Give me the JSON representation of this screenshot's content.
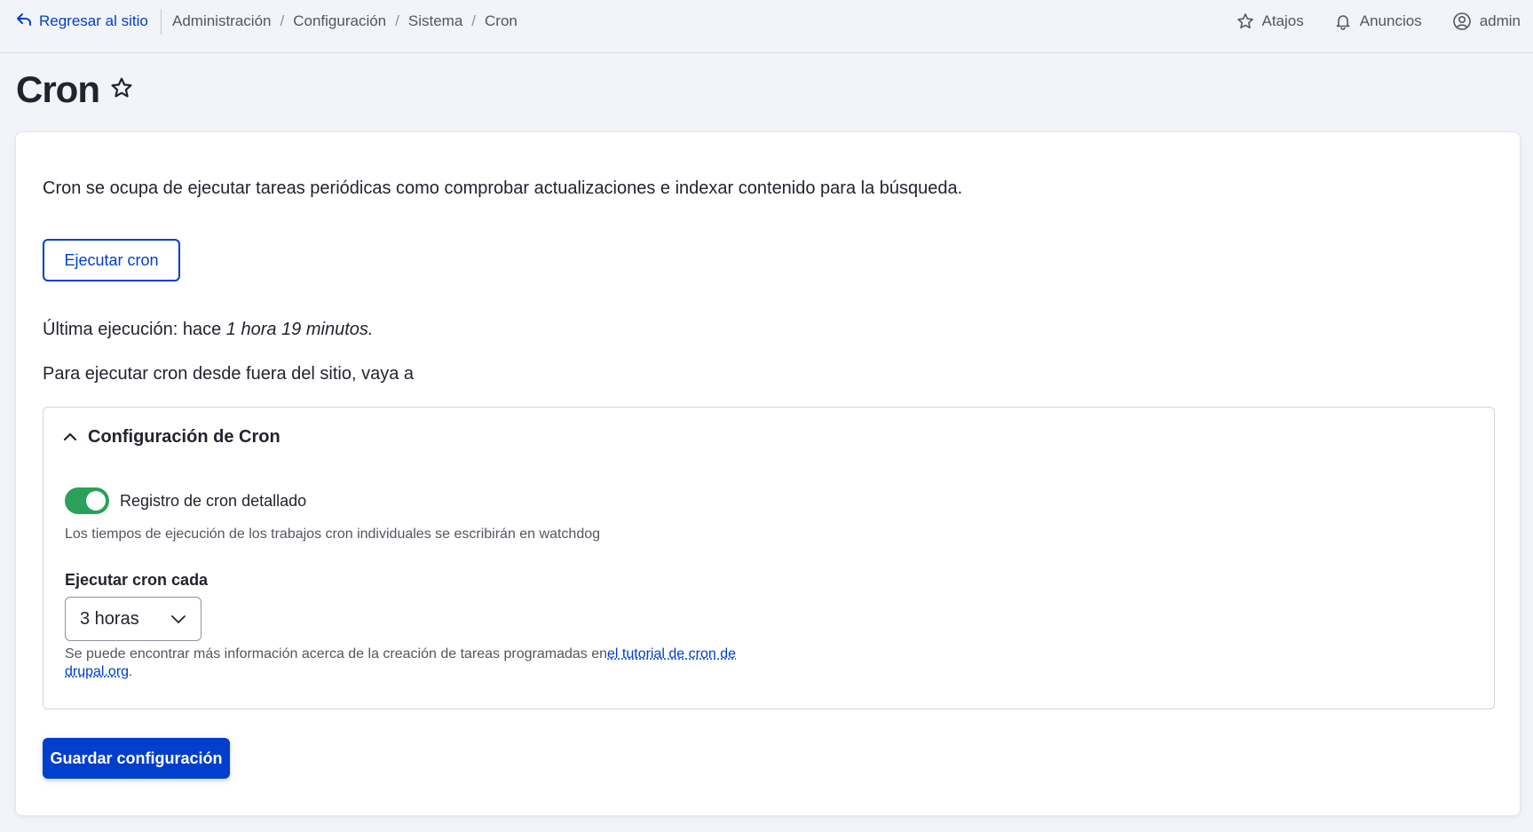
{
  "topbar": {
    "back_label": "Regresar al sitio",
    "breadcrumbs": [
      "Administración",
      "Configuración",
      "Sistema",
      "Cron"
    ],
    "separator": "/",
    "shortcuts_label": "Atajos",
    "announcements_label": "Anuncios",
    "user_label": "admin"
  },
  "page": {
    "title": "Cron"
  },
  "content": {
    "intro": "Cron se ocupa de ejecutar tareas periódicas como comprobar actualizaciones e indexar contenido para la búsqueda.",
    "run_button": "Ejecutar cron",
    "last_run_prefix": "Última ejecución: hace ",
    "last_run_value": "1 hora 19 minutos.",
    "external_text": "Para ejecutar cron desde fuera del sitio, vaya a"
  },
  "settings": {
    "section_title": "Configuración de Cron",
    "logging_label": "Registro de cron detallado",
    "logging_enabled": true,
    "logging_description": "Los tiempos de ejecución de los trabajos cron individuales se escribirán en watchdog",
    "interval_label": "Ejecutar cron cada",
    "interval_value": "3 horas",
    "interval_description_prefix": "Se puede encontrar más información acerca de la creación de tareas programadas en",
    "interval_description_link": "el tutorial de cron de drupal.org",
    "interval_description_suffix": "."
  },
  "actions": {
    "save_label": "Guardar configuración"
  },
  "colors": {
    "accent": "#003ecc",
    "toggle_on": "#2aa05b",
    "background": "#f3f4f9"
  },
  "icons": [
    "back-arrow-icon",
    "star-icon",
    "bell-icon",
    "user-circle-icon",
    "chevron-up-icon",
    "chevron-down-icon"
  ]
}
